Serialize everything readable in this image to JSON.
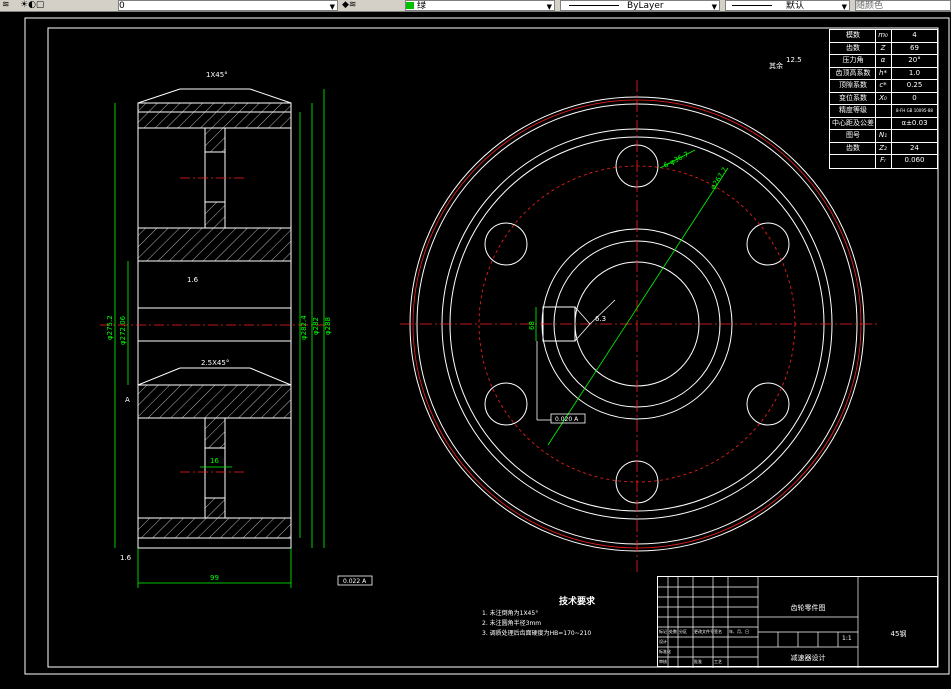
{
  "toolbar": {
    "layer_value": "0",
    "color_value": "绿",
    "linetype_value": "ByLayer",
    "lineweight_value": "默认",
    "plotstyle_value": "随颜色",
    "colors": {
      "toolbar_bg": "#d4d0c8",
      "green_swatch": "#00c000"
    }
  },
  "drawing": {
    "side_view": {
      "chamfer_top": "1X45°",
      "chamfer_hub": "2.5X45°",
      "roughness_top": "1.6",
      "roughness_bottom": "1.6",
      "dim_keyway": "16",
      "dim_width": "99",
      "dim_left_bore": "φ272.06",
      "dim_left_outer": "φ275.2",
      "dim_right_1": "φ282.4",
      "dim_right_2": "φ282",
      "dim_right_3": "φ288",
      "tol_bottom": "0.022 A",
      "datum_label": "A"
    },
    "front_view": {
      "dim_holes": "6-φ36.7",
      "dim_pitch": "φ267.7",
      "dim_slot": "68",
      "roughness_slot": "6.3",
      "tol_bore": "0.020 A",
      "roughness_corner_prefix": "其余",
      "roughness_corner": "12.5"
    },
    "param_table": {
      "rows": [
        {
          "label": "模数",
          "sym": "m₀",
          "val": "4"
        },
        {
          "label": "齿数",
          "sym": "Z",
          "val": "69"
        },
        {
          "label": "压力角",
          "sym": "α",
          "val": "20°"
        },
        {
          "label": "齿顶高系数",
          "sym": "h*",
          "val": "1.0"
        },
        {
          "label": "顶隙系数",
          "sym": "c*",
          "val": "0.25"
        },
        {
          "label": "变位系数",
          "sym": "X₀",
          "val": "0"
        },
        {
          "label": "精度等级",
          "sym": "",
          "val": "8-FH GB 10095-88"
        },
        {
          "label": "中心距及公差",
          "sym": "",
          "val": "α±0.03"
        },
        {
          "label": "图号",
          "sym": "N₁",
          "val": ""
        },
        {
          "label": "齿数",
          "sym": "Z₂",
          "val": "24"
        },
        {
          "label": "",
          "sym": "Fᵣ",
          "val": "0.060"
        }
      ],
      "pair_label": "配对齿轮"
    },
    "notes": {
      "title": "技术要求",
      "items": [
        "1. 未注倒角为1X45°",
        "2. 未注圆角半径3mm",
        "3. 调质处理后齿面硬度为HB=170~210"
      ]
    },
    "title_block": {
      "part_name": "齿轮零件图",
      "material": "45钢",
      "scale": "1:1",
      "small_cells": [
        "标记",
        "处数",
        "分区",
        "更改文件号",
        "签名",
        "年、月、日",
        "设计",
        "标准化",
        "审核",
        "工艺",
        "批准"
      ],
      "project": "减速器设计"
    },
    "colors": {
      "white": "#ffffff",
      "red": "#ff2020",
      "green": "#00ff00",
      "cyan": "#00ffff"
    }
  }
}
